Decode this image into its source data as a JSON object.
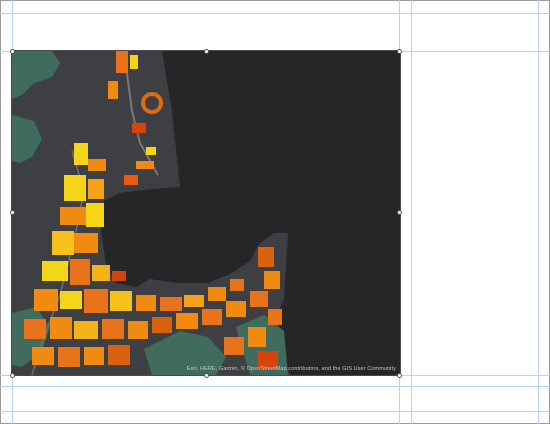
{
  "map": {
    "attribution": "Esri, HERE, Garmin, © OpenStreetMap contributors, and the GIS User Community",
    "colors": {
      "water": "#262528",
      "land": "#3e3f43",
      "park": "#3f6c5c",
      "building_yellow": "#f5d51a",
      "building_orange": "#f18a10",
      "building_red": "#d8420d"
    }
  }
}
